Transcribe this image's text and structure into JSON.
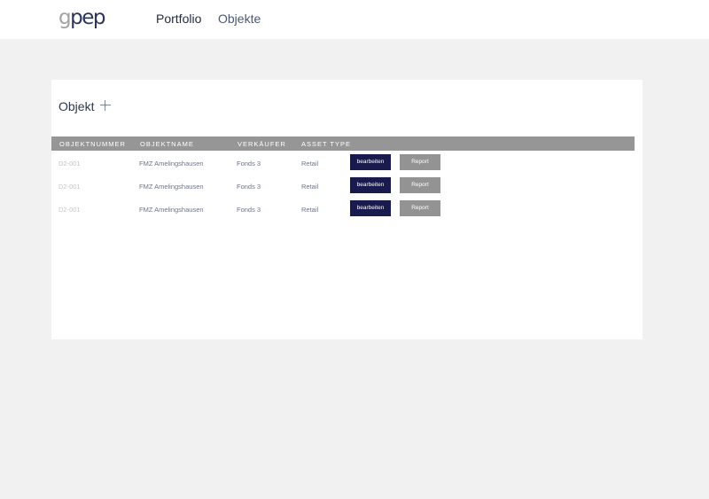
{
  "header": {
    "logo": "gpep",
    "logo_first": "g",
    "logo_rest": "pep",
    "nav": [
      {
        "label": "Portfolio"
      },
      {
        "label": "Objekte"
      }
    ]
  },
  "card": {
    "title": "Objekt",
    "columns": [
      "OBJEKTNUMMER",
      "OBJEKTNAME",
      "VERKÄUFER",
      "ASSET TYPE"
    ],
    "rows": [
      {
        "objektnummer": "D2-001",
        "objektname": "FMZ Amelingshausen",
        "verkaeufer": "Fonds 3",
        "asset_type": "Retail",
        "edit_label": "bearbeiten",
        "report_label": "Report"
      },
      {
        "objektnummer": "D2-001",
        "objektname": "FMZ Amelingshausen",
        "verkaeufer": "Fonds 3",
        "asset_type": "Retail",
        "edit_label": "bearbeiten",
        "report_label": "Report"
      },
      {
        "objektnummer": "D2-001",
        "objektname": "FMZ Amelingshausen",
        "verkaeufer": "Fonds 3",
        "asset_type": "Retail",
        "edit_label": "bearbeiten",
        "report_label": "Report"
      }
    ]
  },
  "colors": {
    "edit_button": "#191a4e",
    "report_button": "#939393",
    "table_header": "#969696",
    "background": "#f1f1f1"
  },
  "icons": {
    "add": "plus-icon"
  }
}
